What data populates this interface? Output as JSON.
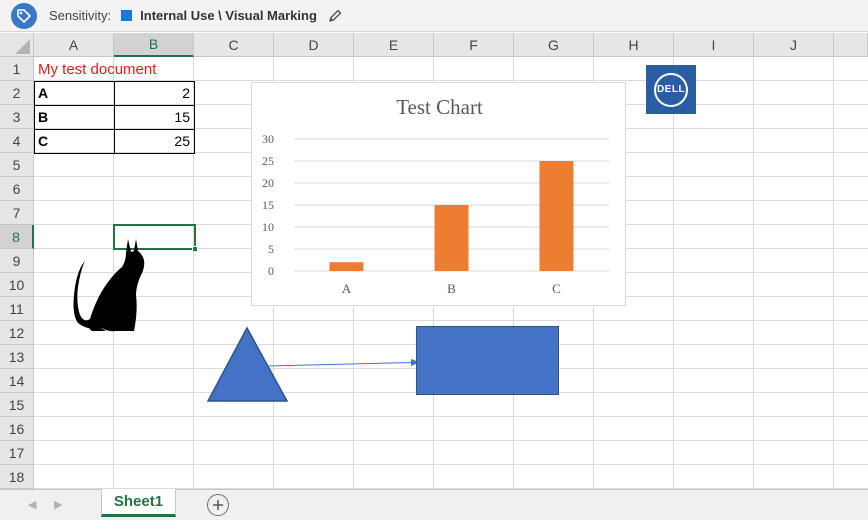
{
  "sensitivity": {
    "label": "Sensitivity:",
    "value": "Internal Use \\ Visual Marking",
    "color": "#1f77d0"
  },
  "columns": [
    "A",
    "B",
    "C",
    "D",
    "E",
    "F",
    "G",
    "H",
    "I",
    "J"
  ],
  "rows": [
    "1",
    "2",
    "3",
    "4",
    "5",
    "6",
    "7",
    "8",
    "9",
    "10",
    "11",
    "12",
    "13",
    "14",
    "15",
    "16",
    "17",
    "18"
  ],
  "selected": {
    "column": "B",
    "row": "8"
  },
  "cells": {
    "a1": "My test document",
    "a2": "A",
    "b2": "2",
    "a3": "B",
    "b3": "15",
    "a4": "C",
    "b4": "25"
  },
  "chart_data": {
    "type": "bar",
    "title": "Test Chart",
    "categories": [
      "A",
      "B",
      "C"
    ],
    "values": [
      2,
      15,
      25
    ],
    "ylim": [
      0,
      30
    ],
    "yticks": [
      "0",
      "5",
      "10",
      "15",
      "20",
      "25",
      "30"
    ],
    "grid": true,
    "bar_color": "#ed7d31",
    "xlabel": "",
    "ylabel": ""
  },
  "logo": {
    "text": "DELL",
    "color": "#2a5ea3"
  },
  "shapes": {
    "fill": "#4472c4",
    "stroke": "#2f528f"
  },
  "sheet_tabs": [
    "Sheet1"
  ],
  "icons": {
    "sensitivity": "tag-icon",
    "edit": "pencil-icon",
    "add_sheet": "plus-circle-icon",
    "prev": "triangle-left-icon",
    "next": "triangle-right-icon"
  }
}
